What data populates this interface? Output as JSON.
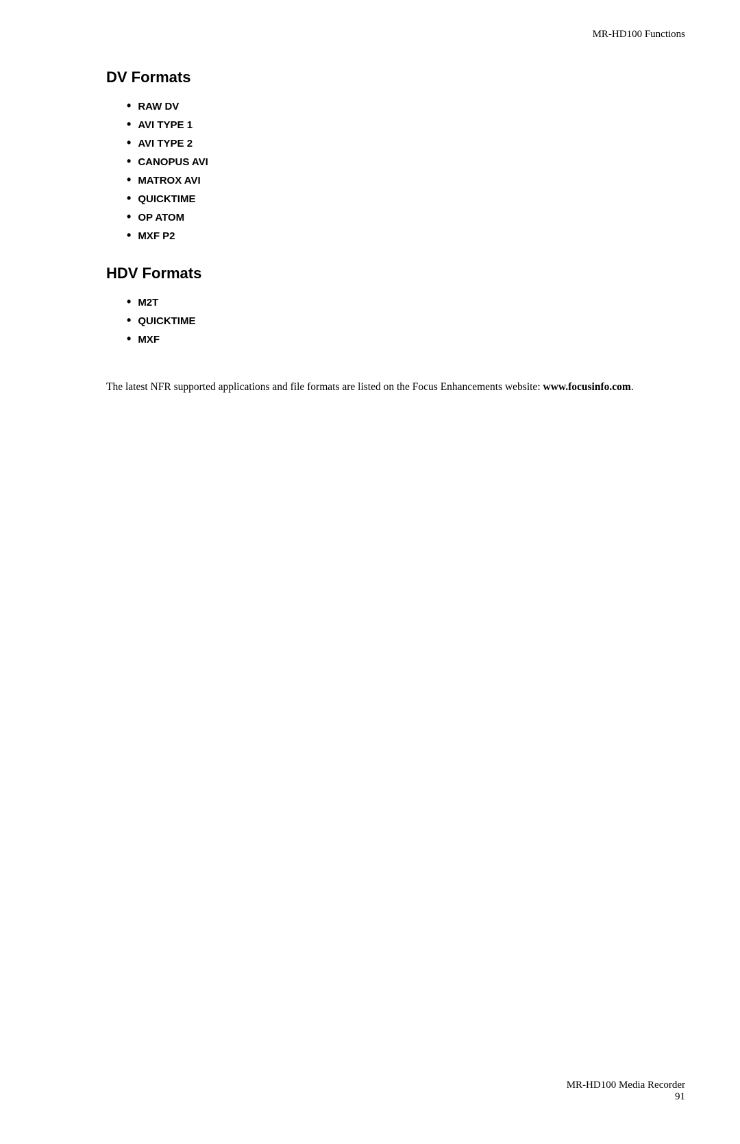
{
  "header": {
    "title": "MR-HD100 Functions"
  },
  "footer": {
    "product": "MR-HD100 Media Recorder",
    "page_number": "91"
  },
  "dv_formats": {
    "heading": "DV Formats",
    "items": [
      "RAW DV",
      "AVI TYPE 1",
      "AVI TYPE 2",
      "CANOPUS AVI",
      "MATROX AVI",
      "QUICKTIME",
      "OP ATOM",
      "MXF P2"
    ]
  },
  "hdv_formats": {
    "heading": "HDV Formats",
    "items": [
      "M2T",
      "QUICKTIME",
      "MXF"
    ]
  },
  "footer_text": {
    "part1": "The latest NFR supported applications and file formats are listed on the Focus Enhancements website: ",
    "website": "www.focusinfo.com",
    "part2": "."
  }
}
